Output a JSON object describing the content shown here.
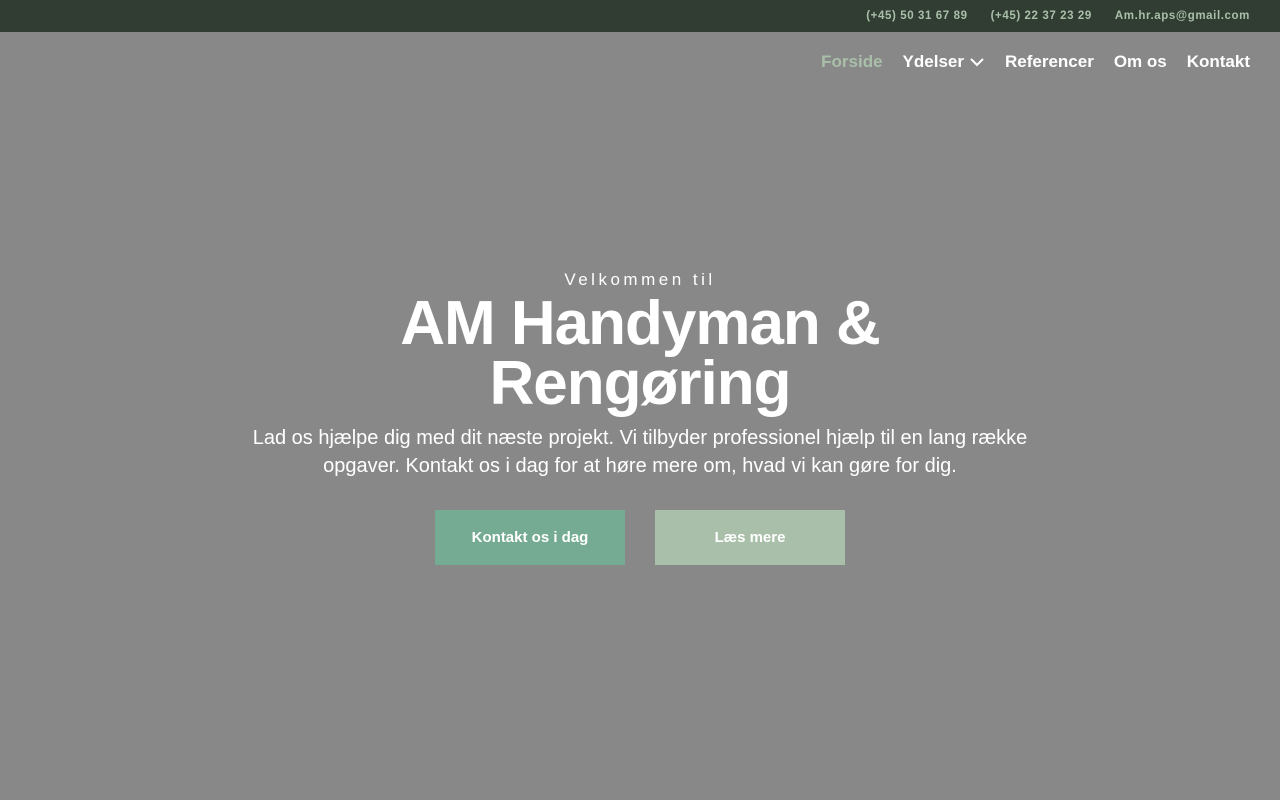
{
  "topbar": {
    "phone1": "(+45) 50 31 67 89",
    "phone2": "(+45) 22 37 23 29",
    "email": "Am.hr.aps@gmail.com"
  },
  "nav": {
    "items": [
      {
        "label": "Forside",
        "active": true
      },
      {
        "label": "Ydelser",
        "has_dropdown": true,
        "icon": "chevron-down-icon"
      },
      {
        "label": "Referencer"
      },
      {
        "label": "Om os"
      },
      {
        "label": "Kontakt"
      }
    ]
  },
  "hero": {
    "eyebrow": "Velkommen til",
    "title": "AM Handyman & Rengøring",
    "subtitle": "Lad os hjælpe dig med dit næste projekt. Vi tilbyder professionel hjælp til en lang række opgaver. Kontakt os i dag for at høre mere om, hvad vi kan gøre for dig.",
    "primary_button": "Kontakt os i dag",
    "secondary_button": "Læs mere"
  },
  "colors": {
    "topbar_bg": "#313d33",
    "accent_light": "#a9bfa9",
    "accent_primary": "#75ab92",
    "hero_bg": "#888888"
  }
}
